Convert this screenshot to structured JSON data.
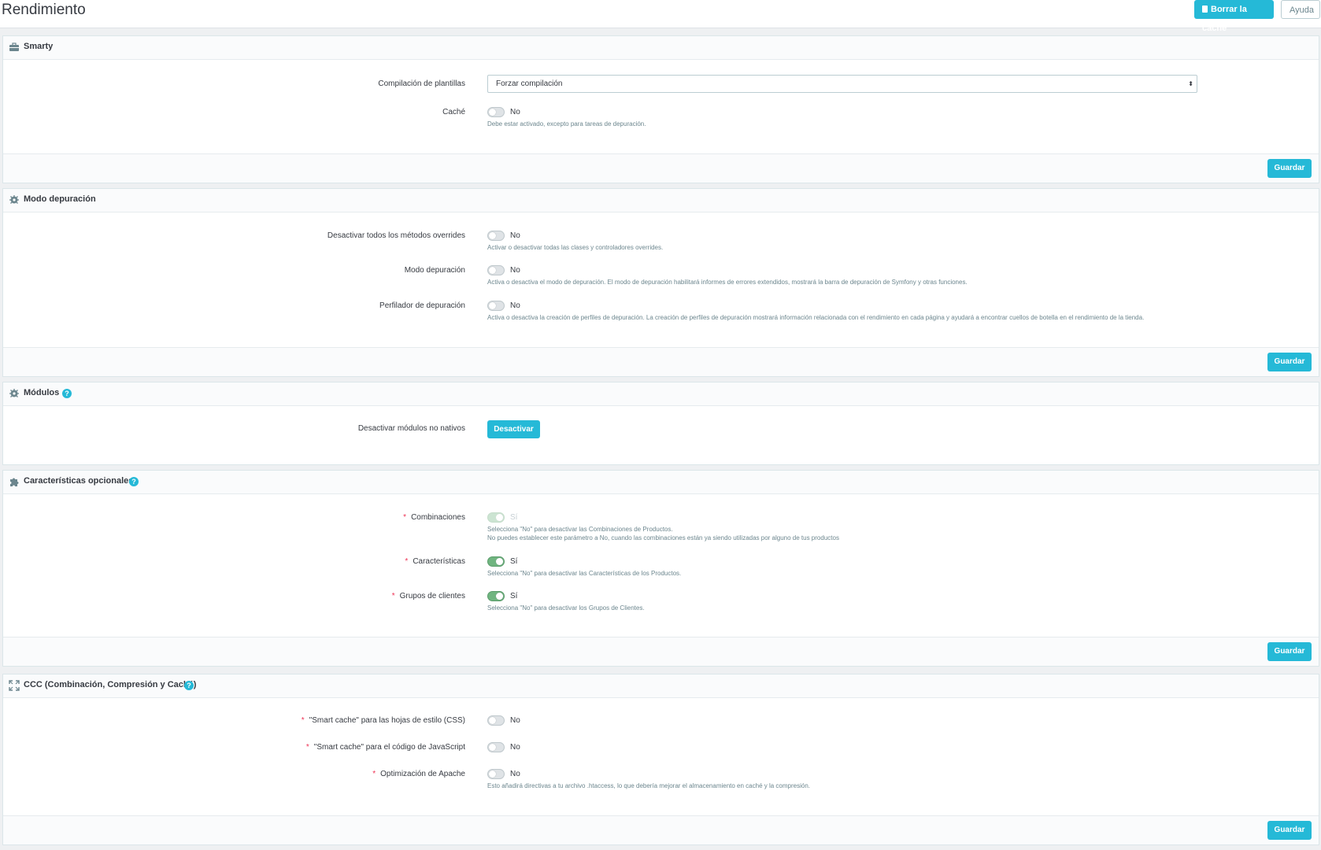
{
  "header": {
    "title": "Rendimiento",
    "clear_cache_label": "Borrar la caché",
    "help_label": "Ayuda"
  },
  "smarty": {
    "title": "Smarty",
    "template_compilation_label": "Compilación de plantillas",
    "template_compilation_value": "Forzar compilación",
    "cache_label": "Caché",
    "cache_value": "No",
    "cache_hint": "Debe estar activado, excepto para tareas de depuración.",
    "save_label": "Guardar"
  },
  "debug": {
    "title": "Modo depuración",
    "overrides_label": "Desactivar todos los métodos overrides",
    "overrides_value": "No",
    "overrides_hint": "Activar o desactivar todas las clases y controladores overrides.",
    "debug_mode_label": "Modo depuración",
    "debug_mode_value": "No",
    "debug_mode_hint": "Activa o desactiva el modo de depuración. El modo de depuración habilitará informes de errores extendidos, mostrará la barra de depuración de Symfony y otras funciones.",
    "profiler_label": "Perfilador de depuración",
    "profiler_value": "No",
    "profiler_hint": "Activa o desactiva la creación de perfiles de depuración. La creación de perfiles de depuración mostrará información relacionada con el rendimiento en cada página y ayudará a encontrar cuellos de botella en el rendimiento de la tienda.",
    "save_label": "Guardar"
  },
  "modules": {
    "title": "Módulos",
    "help": "?",
    "disable_label": "Desactivar módulos no nativos",
    "disable_button": "Desactivar"
  },
  "features": {
    "title": "Características opcionales",
    "help": "?",
    "required_mark": "*",
    "combinations_label": "Combinaciones",
    "combinations_value": "Sí",
    "combinations_hint1": "Selecciona \"No\" para desactivar las Combinaciones de Productos.",
    "combinations_hint2": "No puedes establecer este parámetro a No, cuando las combinaciones están ya siendo utilizadas por alguno de tus productos",
    "features_label": "Características",
    "features_value": "Sí",
    "features_hint": "Selecciona \"No\" para desactivar las Características de los Productos.",
    "groups_label": "Grupos de clientes",
    "groups_value": "Sí",
    "groups_hint": "Selecciona \"No\" para desactivar los Grupos de Clientes.",
    "save_label": "Guardar"
  },
  "ccc": {
    "title": "CCC (Combinación, Compresión y Caché)",
    "help": "?",
    "required_mark": "*",
    "css_label": "\"Smart cache\" para las hojas de estilo (CSS)",
    "css_value": "No",
    "js_label": "\"Smart cache\" para el código de JavaScript",
    "js_value": "No",
    "apache_label": "Optimización de Apache",
    "apache_value": "No",
    "apache_hint": "Esto añadirá directivas a tu archivo .htaccess, lo que debería mejorar el almacenamiento en caché y la compresión.",
    "save_label": "Guardar"
  },
  "colors": {
    "primary": "#25b9d7",
    "switch_on": "#70b580",
    "required": "#e35"
  }
}
